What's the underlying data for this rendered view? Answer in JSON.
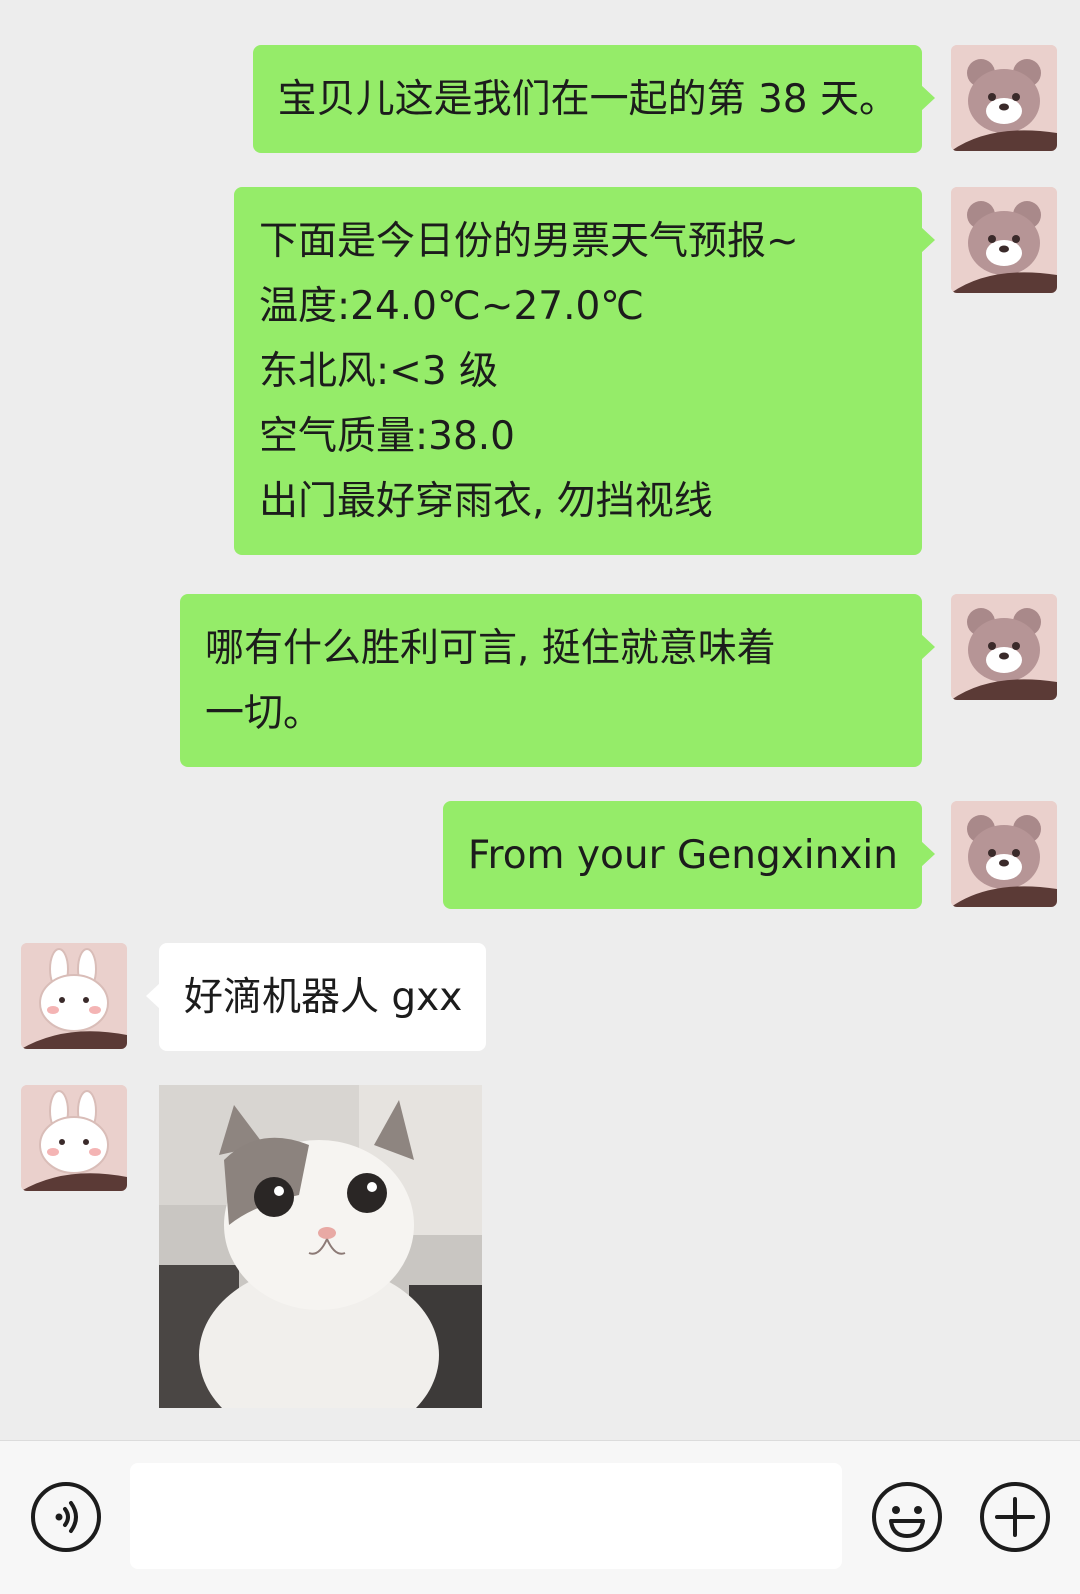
{
  "messages": [
    {
      "side": "out",
      "lines": [
        "宝贝儿这是我们在一起的第 38 天。"
      ]
    },
    {
      "side": "out",
      "lines": [
        "下面是今日份的男票天气预报~",
        "温度:24.0℃~27.0℃",
        "东北风:<3 级",
        "空气质量:38.0",
        "出门最好穿雨衣, 勿挡视线"
      ]
    },
    {
      "side": "out",
      "lines": [
        "哪有什么胜利可言, 挺住就意味着",
        "一切。"
      ]
    },
    {
      "side": "out",
      "lines": [
        "From your Gengxinxin"
      ]
    },
    {
      "side": "in",
      "lines": [
        "好滴机器人 gxx"
      ]
    },
    {
      "side": "in",
      "type": "image",
      "subject": "cat-photo"
    }
  ],
  "avatars": {
    "self": "bear-avatar",
    "other": "bunny-avatar"
  },
  "input_bar": {
    "placeholder": "",
    "voice_icon": "voice-icon",
    "emoji_icon": "emoji-icon",
    "plus_icon": "plus-icon"
  },
  "colors": {
    "background": "#ededed",
    "out_bubble": "#95ec69",
    "in_bubble": "#ffffff"
  }
}
